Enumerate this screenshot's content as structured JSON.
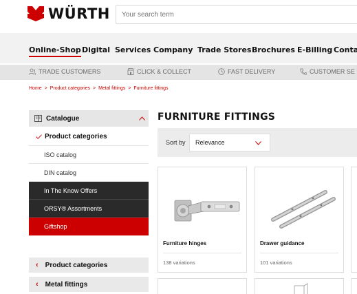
{
  "brand": {
    "name": "WÜRTH",
    "color": "#cc0000"
  },
  "search": {
    "placeholder": "Your search term"
  },
  "mainnav": [
    "Online-Shop",
    "Digital",
    "Services",
    "Company",
    "Trade Stores",
    "Brochures",
    "E-Billing",
    "Conta"
  ],
  "usps": [
    {
      "label": "Trade customers",
      "icon": "users-icon"
    },
    {
      "label": "Click & Collect",
      "icon": "store-icon"
    },
    {
      "label": "Fast delivery",
      "icon": "clock-icon"
    },
    {
      "label": "Customer se",
      "icon": "phone-icon"
    }
  ],
  "breadcrumb": [
    "Home",
    ">",
    "Product categories",
    ">",
    "Metal fittings",
    ">",
    "Furniture fittings"
  ],
  "sidebar": {
    "catalogue": "Catalogue",
    "items": [
      "Product categories",
      "ISO catalog",
      "DIN catalog",
      "In The Know Offers",
      "ORSY® Assortments",
      "Giftshop"
    ],
    "back_links": [
      "Product categories",
      "Metal fittings"
    ]
  },
  "page": {
    "title": "FURNITURE FITTINGS"
  },
  "sort": {
    "label": "Sort by",
    "value": "Relevance"
  },
  "products": [
    {
      "name": "Furniture hinges",
      "variations": "138 variations"
    },
    {
      "name": "Drawer guidance",
      "variations": "101 variations"
    }
  ]
}
